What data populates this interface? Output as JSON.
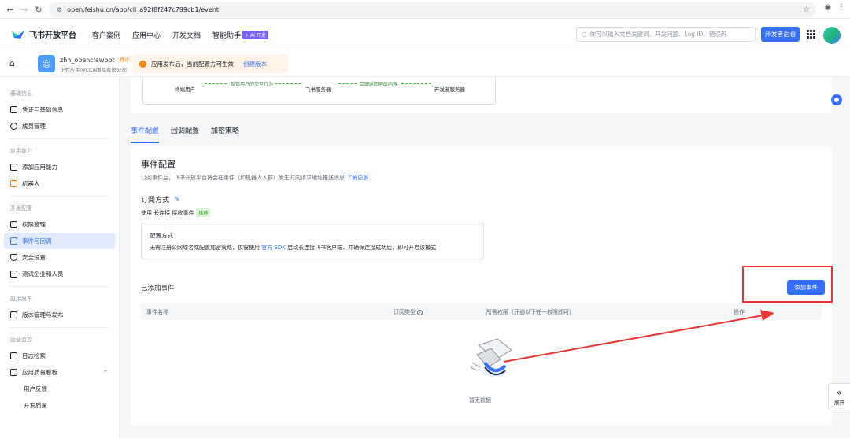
{
  "browser": {
    "url": "open.feishu.cn/app/cli_a92f8f247c799cb1/event"
  },
  "topnav": {
    "brand": "飞书开放平台",
    "links": [
      "客户案例",
      "应用中心",
      "开发文档",
      "智能助手"
    ],
    "ai_badge": "+ AI 开发",
    "search_placeholder": "你可以输入文档关键词、开发问题、Log ID、错误码",
    "console_button": "开发者后台"
  },
  "app": {
    "name": "zhh_openclawbot",
    "status": "停止",
    "owner": "正式应用@CCA国际有限公司",
    "notice": "应用发布后，当前配置方可生效",
    "notice_link": "创建版本"
  },
  "sidebar": {
    "groups": [
      {
        "title": "基础信息",
        "items": [
          "凭证与基础信息",
          "成员管理"
        ]
      },
      {
        "title": "应用能力",
        "items": [
          "添加应用能力",
          "机器人"
        ]
      },
      {
        "title": "开发配置",
        "items": [
          "权限管理",
          "事件与回调",
          "安全设置",
          "测试企业和人员"
        ]
      },
      {
        "title": "应用发布",
        "items": [
          "版本管理与发布"
        ]
      },
      {
        "title": "运营监控",
        "items": [
          "日志检索",
          "应用质量看板",
          "用户反馈",
          "开发质量"
        ]
      }
    ]
  },
  "flow": {
    "node_user": "终端用户",
    "node_server": "飞书服务器",
    "node_dev": "开发者服务器",
    "arrow1": "反馈用户的交互行为",
    "arrow2": "立即返回响应内容"
  },
  "tabs": [
    "事件配置",
    "回调配置",
    "加密策略"
  ],
  "event_config": {
    "title": "事件配置",
    "desc": "订阅事件后，飞书开放平台将会在事件（如机器人入群）发生时向请求地址推送消息",
    "desc_link": "了解更多",
    "subscribe_title": "订阅方式",
    "mode_prefix": "使用 长连接 接收事件",
    "mode_tag": "推荐",
    "box_title": "配置方式",
    "box_text_1": "无需注册公网域名或配置加密策略，仅需使用",
    "box_text_link": "官方 SDK",
    "box_text_2": "启动长连接飞书客户端，并确保连接成功后，即可开启该模式",
    "added_title": "已添加事件",
    "add_button": "添加事件",
    "columns": [
      "事件名称",
      "订阅类型",
      "所需权限（开通以下任一权限即可）",
      "操作"
    ],
    "empty_text": "暂无数据"
  },
  "collapse_label": "展开"
}
